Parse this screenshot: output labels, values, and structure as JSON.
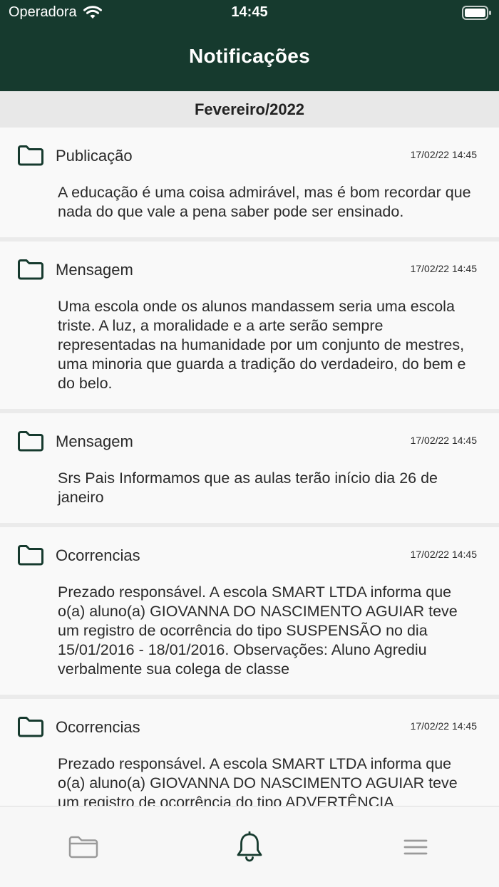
{
  "status": {
    "carrier": "Operadora",
    "time": "14:45"
  },
  "header": {
    "title": "Notificações"
  },
  "section": {
    "month": "Fevereiro/2022"
  },
  "notifications": [
    {
      "type": "Publicação",
      "date": "17/02/22 14:45",
      "text": "A educação é uma coisa admirável, mas é bom recordar que nada do que vale a pena saber pode ser ensinado."
    },
    {
      "type": "Mensagem",
      "date": "17/02/22 14:45",
      "text": "Uma escola onde os alunos mandassem seria uma escola triste. A luz, a moralidade e a arte serão sempre representadas na humanidade por um conjunto de mestres, uma minoria que guarda a tradição do verdadeiro, do bem e do belo."
    },
    {
      "type": "Mensagem",
      "date": "17/02/22 14:45",
      "text": "Srs Pais Informamos que as aulas terão início dia 26 de janeiro"
    },
    {
      "type": "Ocorrencias",
      "date": "17/02/22 14:45",
      "text": "Prezado responsável. A escola SMART LTDA informa que o(a) aluno(a) GIOVANNA DO NASCIMENTO AGUIAR teve um registro de ocorrência do tipo SUSPENSÃO no dia 15/01/2016 - 18/01/2016. Observações: Aluno Agrediu verbalmente sua colega de classe"
    },
    {
      "type": "Ocorrencias",
      "date": "17/02/22 14:45",
      "text": "Prezado responsável. A escola SMART LTDA informa que o(a) aluno(a) GIOVANNA DO NASCIMENTO AGUIAR teve um registro de ocorrência do tipo ADVERTÊNCIA"
    }
  ],
  "tabbar": {
    "icons": [
      "folder-icon",
      "bell-icon",
      "menu-icon"
    ]
  },
  "colors": {
    "primary": "#163a2e",
    "background": "#ebebeb",
    "card": "#f9f9f9"
  }
}
